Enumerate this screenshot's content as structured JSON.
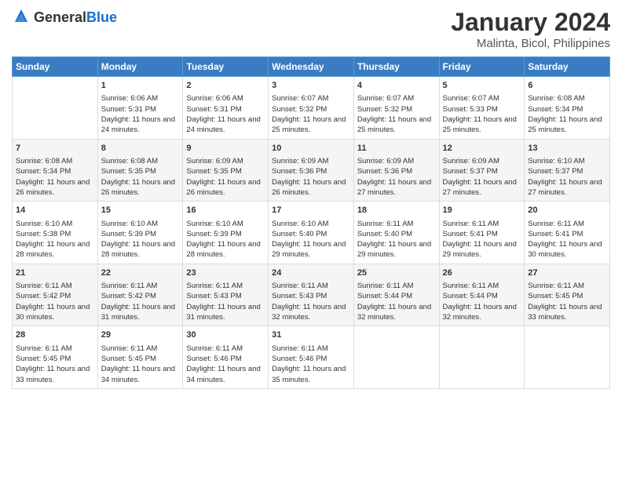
{
  "header": {
    "logo_general": "General",
    "logo_blue": "Blue",
    "month_year": "January 2024",
    "location": "Malinta, Bicol, Philippines"
  },
  "weekdays": [
    "Sunday",
    "Monday",
    "Tuesday",
    "Wednesday",
    "Thursday",
    "Friday",
    "Saturday"
  ],
  "weeks": [
    [
      {
        "day": "",
        "info": ""
      },
      {
        "day": "1",
        "info": "Sunrise: 6:06 AM\nSunset: 5:31 PM\nDaylight: 11 hours\nand 24 minutes."
      },
      {
        "day": "2",
        "info": "Sunrise: 6:06 AM\nSunset: 5:31 PM\nDaylight: 11 hours\nand 24 minutes."
      },
      {
        "day": "3",
        "info": "Sunrise: 6:07 AM\nSunset: 5:32 PM\nDaylight: 11 hours\nand 25 minutes."
      },
      {
        "day": "4",
        "info": "Sunrise: 6:07 AM\nSunset: 5:32 PM\nDaylight: 11 hours\nand 25 minutes."
      },
      {
        "day": "5",
        "info": "Sunrise: 6:07 AM\nSunset: 5:33 PM\nDaylight: 11 hours\nand 25 minutes."
      },
      {
        "day": "6",
        "info": "Sunrise: 6:08 AM\nSunset: 5:34 PM\nDaylight: 11 hours\nand 25 minutes."
      }
    ],
    [
      {
        "day": "7",
        "info": "Sunrise: 6:08 AM\nSunset: 5:34 PM\nDaylight: 11 hours\nand 26 minutes."
      },
      {
        "day": "8",
        "info": "Sunrise: 6:08 AM\nSunset: 5:35 PM\nDaylight: 11 hours\nand 26 minutes."
      },
      {
        "day": "9",
        "info": "Sunrise: 6:09 AM\nSunset: 5:35 PM\nDaylight: 11 hours\nand 26 minutes."
      },
      {
        "day": "10",
        "info": "Sunrise: 6:09 AM\nSunset: 5:36 PM\nDaylight: 11 hours\nand 26 minutes."
      },
      {
        "day": "11",
        "info": "Sunrise: 6:09 AM\nSunset: 5:36 PM\nDaylight: 11 hours\nand 27 minutes."
      },
      {
        "day": "12",
        "info": "Sunrise: 6:09 AM\nSunset: 5:37 PM\nDaylight: 11 hours\nand 27 minutes."
      },
      {
        "day": "13",
        "info": "Sunrise: 6:10 AM\nSunset: 5:37 PM\nDaylight: 11 hours\nand 27 minutes."
      }
    ],
    [
      {
        "day": "14",
        "info": "Sunrise: 6:10 AM\nSunset: 5:38 PM\nDaylight: 11 hours\nand 28 minutes."
      },
      {
        "day": "15",
        "info": "Sunrise: 6:10 AM\nSunset: 5:39 PM\nDaylight: 11 hours\nand 28 minutes."
      },
      {
        "day": "16",
        "info": "Sunrise: 6:10 AM\nSunset: 5:39 PM\nDaylight: 11 hours\nand 28 minutes."
      },
      {
        "day": "17",
        "info": "Sunrise: 6:10 AM\nSunset: 5:40 PM\nDaylight: 11 hours\nand 29 minutes."
      },
      {
        "day": "18",
        "info": "Sunrise: 6:11 AM\nSunset: 5:40 PM\nDaylight: 11 hours\nand 29 minutes."
      },
      {
        "day": "19",
        "info": "Sunrise: 6:11 AM\nSunset: 5:41 PM\nDaylight: 11 hours\nand 29 minutes."
      },
      {
        "day": "20",
        "info": "Sunrise: 6:11 AM\nSunset: 5:41 PM\nDaylight: 11 hours\nand 30 minutes."
      }
    ],
    [
      {
        "day": "21",
        "info": "Sunrise: 6:11 AM\nSunset: 5:42 PM\nDaylight: 11 hours\nand 30 minutes."
      },
      {
        "day": "22",
        "info": "Sunrise: 6:11 AM\nSunset: 5:42 PM\nDaylight: 11 hours\nand 31 minutes."
      },
      {
        "day": "23",
        "info": "Sunrise: 6:11 AM\nSunset: 5:43 PM\nDaylight: 11 hours\nand 31 minutes."
      },
      {
        "day": "24",
        "info": "Sunrise: 6:11 AM\nSunset: 5:43 PM\nDaylight: 11 hours\nand 32 minutes."
      },
      {
        "day": "25",
        "info": "Sunrise: 6:11 AM\nSunset: 5:44 PM\nDaylight: 11 hours\nand 32 minutes."
      },
      {
        "day": "26",
        "info": "Sunrise: 6:11 AM\nSunset: 5:44 PM\nDaylight: 11 hours\nand 32 minutes."
      },
      {
        "day": "27",
        "info": "Sunrise: 6:11 AM\nSunset: 5:45 PM\nDaylight: 11 hours\nand 33 minutes."
      }
    ],
    [
      {
        "day": "28",
        "info": "Sunrise: 6:11 AM\nSunset: 5:45 PM\nDaylight: 11 hours\nand 33 minutes."
      },
      {
        "day": "29",
        "info": "Sunrise: 6:11 AM\nSunset: 5:45 PM\nDaylight: 11 hours\nand 34 minutes."
      },
      {
        "day": "30",
        "info": "Sunrise: 6:11 AM\nSunset: 5:46 PM\nDaylight: 11 hours\nand 34 minutes."
      },
      {
        "day": "31",
        "info": "Sunrise: 6:11 AM\nSunset: 5:46 PM\nDaylight: 11 hours\nand 35 minutes."
      },
      {
        "day": "",
        "info": ""
      },
      {
        "day": "",
        "info": ""
      },
      {
        "day": "",
        "info": ""
      }
    ]
  ]
}
